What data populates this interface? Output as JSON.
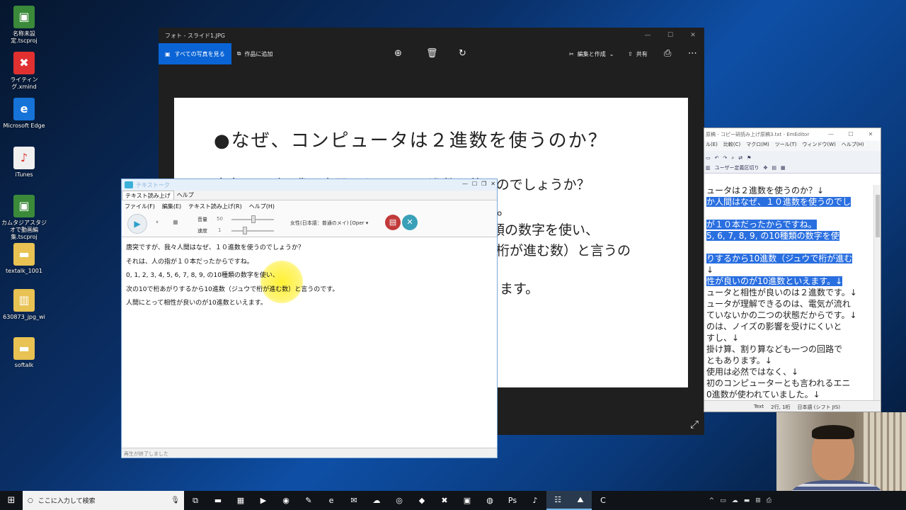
{
  "desktop": {
    "icons": [
      {
        "name": "名称未設定.tscproj",
        "icon": "camtasia-project-icon",
        "color": "#3a8a3a"
      },
      {
        "name": "ライティング.xmind",
        "icon": "xmind-icon",
        "color": "#e03030"
      },
      {
        "name": "Microsoft Edge",
        "icon": "edge-icon",
        "color": "#1673d8"
      },
      {
        "name": "iTunes",
        "icon": "itunes-icon",
        "color": "#f0f0f0"
      },
      {
        "name": "カムタジアスタジオで動画編集.tscproj",
        "icon": "camtasia-project-icon",
        "color": "#3a8a3a"
      },
      {
        "name": "textalk_1001",
        "icon": "folder-icon",
        "color": "#e8c252"
      },
      {
        "name": "630873_jpg_wi",
        "icon": "zip-folder-icon",
        "color": "#e8c252"
      },
      {
        "name": "softalk",
        "icon": "folder-icon",
        "color": "#e8c252"
      }
    ]
  },
  "photos": {
    "title": "フォト - スライド1.JPG",
    "all_photos_label": "すべての写真を見る",
    "add_to_creation_label": "作品に追加",
    "edit_create_label": "編集と作成",
    "share_label": "共有",
    "slide": {
      "heading": "●なぜ、コンピュータは２進数を使うのか？",
      "line1": "唐突ですが、我々人間はなぜ、１０進数を使うのでしょうか？",
      "line2_right": "。",
      "line3_right": "類の数字を使い、",
      "line4_right": "桁が進む数）と言うの",
      "line5_right": "ます。"
    }
  },
  "emeditor": {
    "title": "原稿 - コピー研読み上げ原稿3.txt - EmEditor",
    "menu": [
      "ル(E)",
      "比較(C)",
      "マクロ(M)",
      "ツール(T)",
      "ウィンドウ(W)",
      "ヘルプ(H)"
    ],
    "toolbar_label": "ユーザー定義区切り",
    "lines": [
      {
        "text": "ュータは２進数を使うのか？↓",
        "selected": false
      },
      {
        "text": "か人間はなぜ、１０進数を使うのでし",
        "selected": true
      },
      {
        "text": "",
        "selected": false
      },
      {
        "text": "が１０本だったからですね。",
        "selected": true
      },
      {
        "text": "5, 6, 7, 8, 9, の10種類の数字を使",
        "selected": true
      },
      {
        "text": "",
        "selected": false
      },
      {
        "text": "りするから10進数（ジュウで桁が進む",
        "selected": true
      },
      {
        "text": "↓",
        "selected": false
      },
      {
        "text": "性が良いのが10進数といえます。↓",
        "selected": true
      },
      {
        "text": "ュータと相性が良いのは２進数です。↓",
        "selected": false
      },
      {
        "text": "ュータが理解できるのは、電気が流れ",
        "selected": false
      },
      {
        "text": "ていないかの二つの状態だからです。↓",
        "selected": false
      },
      {
        "text": "のは、ノイズの影響を受けにくいと",
        "selected": false
      },
      {
        "text": "すし、↓",
        "selected": false
      },
      {
        "text": "掛け算、割り算なども一つの回路で",
        "selected": false
      },
      {
        "text": "ともあります。↓",
        "selected": false
      },
      {
        "text": "使用は必然ではなく、↓",
        "selected": false
      },
      {
        "text": "初のコンピューターとも言われるエニ",
        "selected": false
      },
      {
        "text": "0進数が使われていました。↓",
        "selected": false
      }
    ],
    "status_text": "Text",
    "status_pos": "2行, 1桁",
    "status_enc": "日本語 (シフト JIS)"
  },
  "texttalk": {
    "title": "テキストーク",
    "tabs": [
      "テキスト読み上げ",
      "ヘルプ"
    ],
    "menu": [
      "ファイル(F)",
      "編集(E)",
      "テキスト読み上げ(R)",
      "ヘルプ(H)"
    ],
    "volume_label": "音量",
    "volume_value": "50",
    "speed_label": "速度",
    "speed_value": "1",
    "voice": "女性(日本語：普通のメイ) [Oper ▾",
    "body_lines": [
      "唐突ですが、我々人間はなぜ、１０進数を使うのでしょうか？",
      "それは、人の指が１０本だったからですね。",
      "0,  1,  2,  3,  4,  5,  6,  7,  8,  9,  の10種類の数字を使い、",
      "次の10で桁あがりするから10進数（ジュウで桁が進む数）と言うのです。",
      "人間にとって相性が良いのが10進数といえます。"
    ],
    "status": "再生が終了しました"
  },
  "taskbar": {
    "search_placeholder": "ここに入力して検索",
    "apps": [
      {
        "icon": "task-view-icon",
        "glyph": "⧉",
        "active": false
      },
      {
        "icon": "file-explorer-icon",
        "glyph": "▬",
        "active": false
      },
      {
        "icon": "store-icon",
        "glyph": "▦",
        "active": false
      },
      {
        "icon": "media-icon",
        "glyph": "▶",
        "active": false
      },
      {
        "icon": "record-icon",
        "glyph": "◉",
        "active": false
      },
      {
        "icon": "notepad-icon",
        "glyph": "✎",
        "active": false
      },
      {
        "icon": "edge-icon",
        "glyph": "e",
        "active": false
      },
      {
        "icon": "mail-icon",
        "glyph": "✉",
        "active": false
      },
      {
        "icon": "cloud-icon",
        "glyph": "☁",
        "active": false
      },
      {
        "icon": "zoom-icon",
        "glyph": "◎",
        "active": false
      },
      {
        "icon": "diamond-icon",
        "glyph": "◆",
        "active": false
      },
      {
        "icon": "xmind-icon",
        "glyph": "✖",
        "active": false
      },
      {
        "icon": "image-app-icon",
        "glyph": "▣",
        "active": false
      },
      {
        "icon": "chrome-icon",
        "glyph": "◍",
        "active": false
      },
      {
        "icon": "photoshop-icon",
        "glyph": "Ps",
        "active": false
      },
      {
        "icon": "itunes-icon",
        "glyph": "♪",
        "active": false
      },
      {
        "icon": "texttalk-icon",
        "glyph": "☷",
        "active": true
      },
      {
        "icon": "photos-icon",
        "glyph": "⛰",
        "active": true
      },
      {
        "icon": "camtasia-icon",
        "glyph": "C",
        "active": false
      }
    ],
    "tray": [
      "^",
      "▭",
      "☁",
      "▬",
      "⊞",
      "⎙"
    ]
  }
}
